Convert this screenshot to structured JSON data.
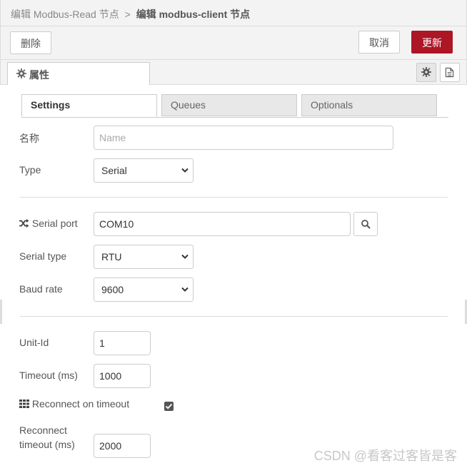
{
  "header": {
    "parent": "编辑 Modbus-Read 节点",
    "separator": ">",
    "current": "编辑 modbus-client 节点"
  },
  "toolbar": {
    "delete_label": "删除",
    "cancel_label": "取消",
    "update_label": "更新",
    "update_color": "#ad1625"
  },
  "node_tabs": {
    "properties_label": "属性"
  },
  "subtabs": [
    "Settings",
    "Queues",
    "Optionals"
  ],
  "form": {
    "name_label": "名称",
    "name_placeholder": "Name",
    "type_label": "Type",
    "type_value": "Serial",
    "serial_port_label": "Serial port",
    "serial_port_value": "COM10",
    "serial_type_label": "Serial type",
    "serial_type_value": "RTU",
    "baud_rate_label": "Baud rate",
    "baud_rate_value": "9600",
    "unit_id_label": "Unit-Id",
    "unit_id_value": "1",
    "timeout_label": "Timeout (ms)",
    "timeout_value": "1000",
    "reconnect_on_timeout_label": "Reconnect on timeout",
    "reconnect_on_timeout_checked": true,
    "reconnect_timeout_label_line1": "Reconnect",
    "reconnect_timeout_label_line2": "timeout (ms)",
    "reconnect_timeout_value": "2000"
  },
  "watermark": "CSDN @看客过客皆是客",
  "icons": {
    "gear": "gear-icon",
    "document": "document-icon",
    "shuffle": "shuffle-icon",
    "grid": "grid-icon",
    "search": "search-icon",
    "chevron": "chevron-down-icon"
  }
}
